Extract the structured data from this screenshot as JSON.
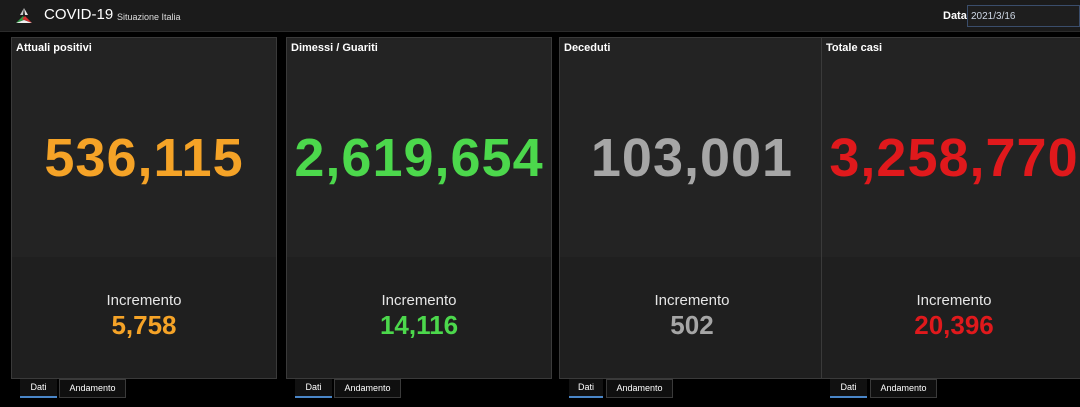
{
  "header": {
    "title": "COVID-19",
    "subtitle": "Situazione Italia",
    "date_label": "Data",
    "date_value": "2021/3/16",
    "logo_icon": "italy-flag-mark-icon"
  },
  "cards": [
    {
      "title": "Attuali positivi",
      "value": "536,115",
      "increment_label": "Incremento",
      "increment_value": "5,758",
      "color": "#f5a327"
    },
    {
      "title": "Dimessi / Guariti",
      "value": "2,619,654",
      "increment_label": "Incremento",
      "increment_value": "14,116",
      "color": "#4cd84c"
    },
    {
      "title": "Deceduti",
      "value": "103,001",
      "increment_label": "Incremento",
      "increment_value": "502",
      "color": "#a6a6a6"
    },
    {
      "title": "Totale casi",
      "value": "3,258,770",
      "increment_label": "Incremento",
      "increment_value": "20,396",
      "color": "#e0191c"
    }
  ],
  "tabs": {
    "dati": "Dati",
    "andamento": "Andamento",
    "active": "Dati"
  }
}
